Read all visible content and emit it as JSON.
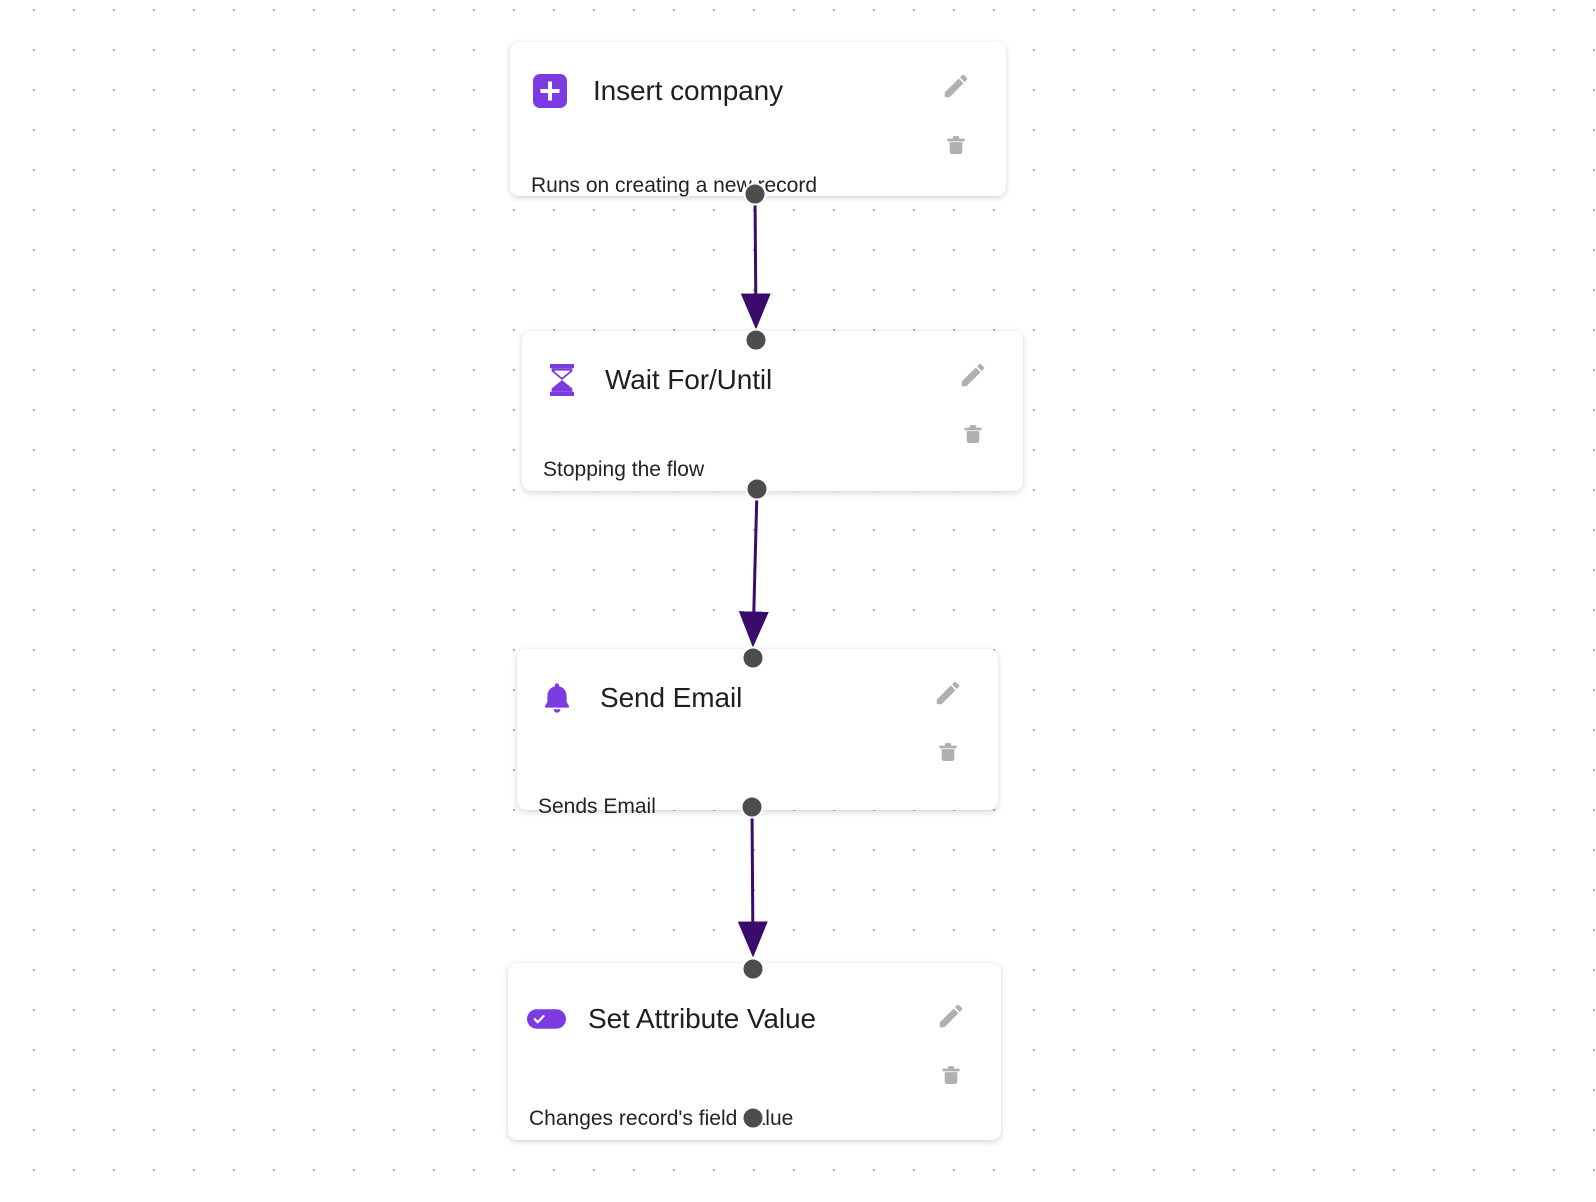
{
  "canvas": {
    "background_color": "#ffffff",
    "grid_dot_color": "#b4b4b4",
    "grid_spacing_px": 40
  },
  "theme": {
    "accent_purple": "#7B3BE0",
    "connector_purple": "#3B0B6B",
    "port_gray": "#4d4d4d",
    "action_icon_gray": "#b0b0b0",
    "title_color": "#1f1f1f",
    "subtitle_color": "#232323"
  },
  "workflow": {
    "name": "workflow-canvas",
    "nodes": [
      {
        "id": "insert-company",
        "title": "Insert company",
        "subtitle": "Runs on creating a new record",
        "icon": "plus-square-icon",
        "icon_color": "#7B3BE0",
        "edit_label": "Edit",
        "delete_label": "Delete",
        "has_input_port": false,
        "has_output_port": true
      },
      {
        "id": "wait-for-until",
        "title": "Wait For/Until",
        "subtitle": "Stopping the flow",
        "icon": "hourglass-icon",
        "icon_color": "#7B3BE0",
        "edit_label": "Edit",
        "delete_label": "Delete",
        "has_input_port": true,
        "has_output_port": true
      },
      {
        "id": "send-email",
        "title": "Send Email",
        "subtitle": "Sends Email",
        "icon": "bell-icon",
        "icon_color": "#7B3BE0",
        "edit_label": "Edit",
        "delete_label": "Delete",
        "has_input_port": true,
        "has_output_port": true
      },
      {
        "id": "set-attribute-value",
        "title": "Set Attribute Value",
        "subtitle": "Changes record's field value",
        "icon": "toggle-check-icon",
        "icon_color": "#7B3BE0",
        "edit_label": "Edit",
        "delete_label": "Delete",
        "has_input_port": true,
        "has_output_port": true
      }
    ],
    "connections": [
      {
        "from": "insert-company",
        "to": "wait-for-until"
      },
      {
        "from": "wait-for-until",
        "to": "send-email"
      },
      {
        "from": "send-email",
        "to": "set-attribute-value"
      }
    ]
  }
}
